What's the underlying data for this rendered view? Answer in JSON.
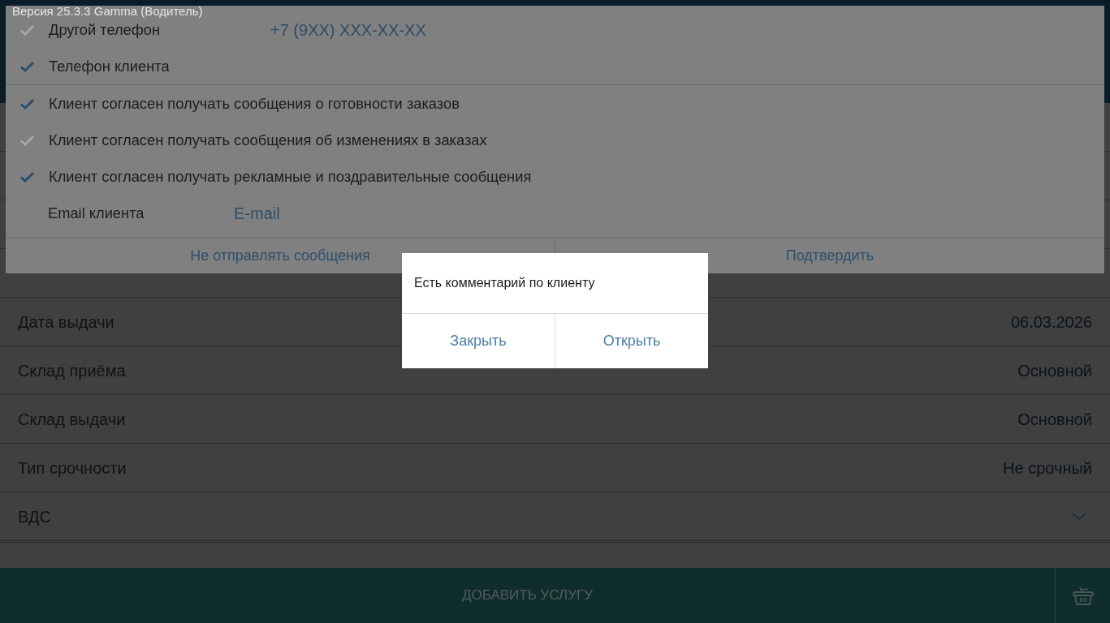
{
  "version_label": "Версия 25.3.3 Gamma (Водитель)",
  "order_fields": [
    {
      "kind": "value",
      "label": "Дата выдачи",
      "value": "06.03.2026"
    },
    {
      "kind": "value",
      "label": "Склад приёма",
      "value": "Основной"
    },
    {
      "kind": "value",
      "label": "Склад выдачи",
      "value": "Основной"
    },
    {
      "kind": "value",
      "label": "Тип срочности",
      "value": "Не срочный"
    },
    {
      "kind": "dropdown",
      "label": "ВДС"
    }
  ],
  "bottom_bar": {
    "button": "ДОБАВИТЬ УСЛУГУ"
  },
  "message_sheet": {
    "phone_options": [
      {
        "label": "Другой телефон",
        "checked": false,
        "placeholder": "+7 (9XX) XXX-XX-XX"
      },
      {
        "label": "Телефон клиента",
        "checked": true
      }
    ],
    "consents": [
      {
        "label": "Клиент согласен получать сообщения о готовности заказов",
        "checked": true
      },
      {
        "label": "Клиент согласен получать сообщения об изменениях в заказах",
        "checked": false
      },
      {
        "label": "Клиент согласен получать рекламные и поздравительные сообщения",
        "checked": true
      }
    ],
    "email": {
      "label": "Email клиента",
      "placeholder": "E-mail"
    },
    "buttons": [
      "Не отправлять сообщения",
      "Подтвердить"
    ]
  },
  "comment_dialog": {
    "message": "Есть комментарий по клиенту",
    "buttons": [
      "Закрыть",
      "Открыть"
    ]
  }
}
